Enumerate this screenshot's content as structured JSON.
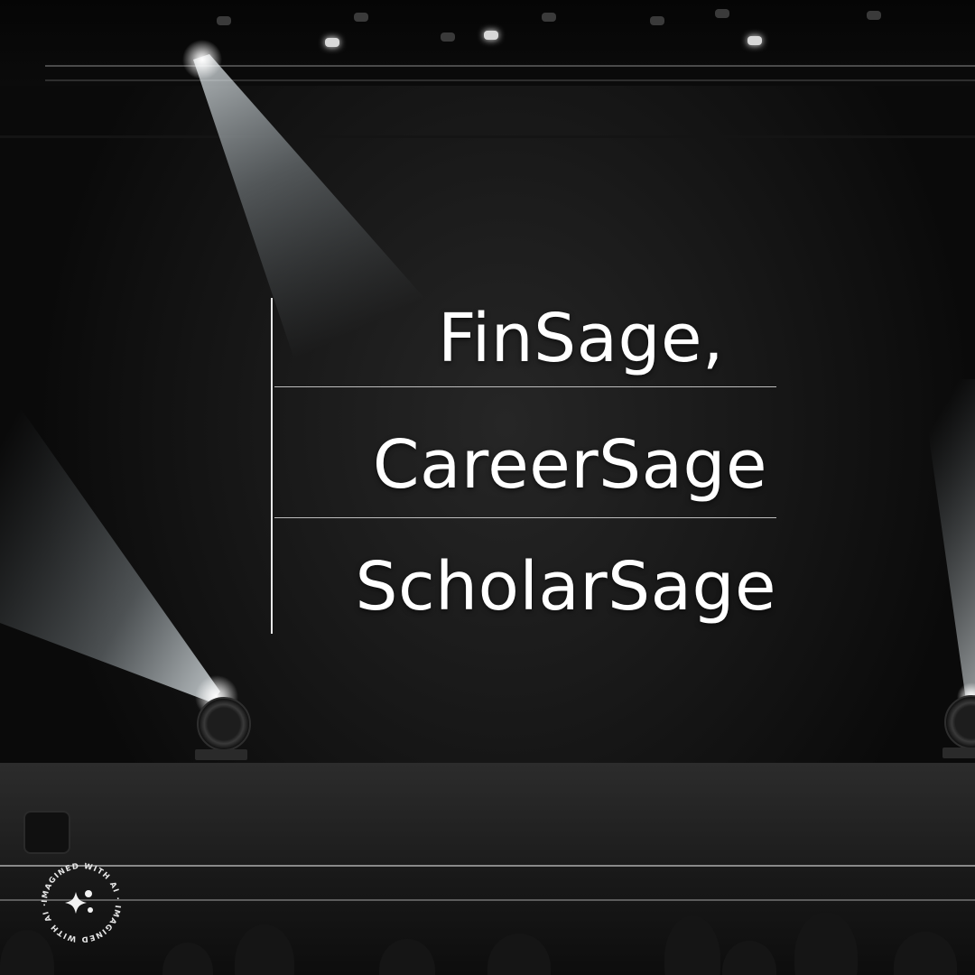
{
  "headline": {
    "line_1": "FinSage,",
    "line_2": "CareerSage",
    "line_3": "ScholarSage"
  },
  "watermark": {
    "text": "IMAGINED WITH AI · IMAGINED WITH AI ·",
    "icon": "sparkle-icon"
  },
  "colors": {
    "background": "#0c0c0c",
    "text": "#ffffff",
    "beam": "#dfe9ee"
  }
}
